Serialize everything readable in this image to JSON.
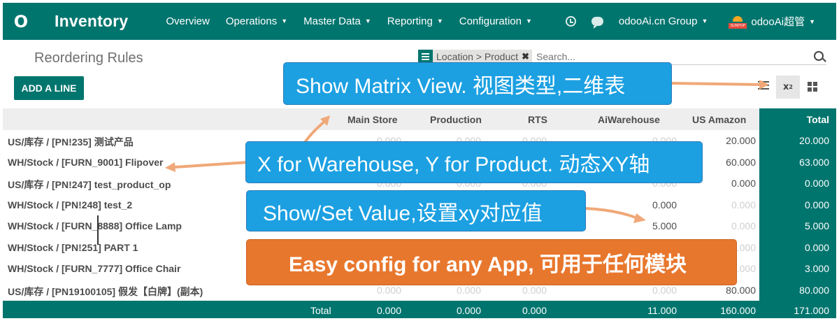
{
  "navbar": {
    "logo": "O",
    "app_title": "Inventory",
    "menu": [
      "Overview",
      "Operations",
      "Master Data",
      "Reporting",
      "Configuration"
    ],
    "menu_has_caret": [
      false,
      true,
      true,
      true,
      true
    ],
    "company": "odooAi.cn Group",
    "user": "odooAi超管",
    "avatar_text": "SUNPOP"
  },
  "control": {
    "breadcrumb": "Reordering Rules",
    "search_facet": "Location > Product",
    "search_placeholder": "Search...",
    "add_button": "ADD A LINE",
    "matrix_view_label": "x",
    "matrix_view_sub": "2"
  },
  "table": {
    "columns": [
      "Main Store",
      "Production",
      "RTS",
      "AiWarehouse",
      "US Amazon"
    ],
    "total_header": "Total",
    "rows": [
      {
        "label": "US/库存 / [PN!235] 测试产品",
        "values": [
          "0.000",
          "0.000",
          "0.000",
          "0.000",
          "20.000"
        ],
        "set": [
          false,
          false,
          false,
          false,
          true
        ],
        "total": "20.000"
      },
      {
        "label": "WH/Stock / [FURN_9001] Flipover",
        "values": [
          "",
          "",
          "",
          "",
          "60.000"
        ],
        "set": [
          false,
          false,
          false,
          false,
          true
        ],
        "total": "63.000"
      },
      {
        "label": "US/库存 / [PN!247] test_product_op",
        "values": [
          "0.000",
          "0.000",
          "0.000",
          "0.000",
          "0.000"
        ],
        "set": [
          false,
          false,
          false,
          false,
          true
        ],
        "total": "0.000"
      },
      {
        "label": "WH/Stock / [PN!248] test_2",
        "values": [
          "",
          "",
          "",
          "0.000",
          "0.000"
        ],
        "set": [
          false,
          false,
          false,
          true,
          false
        ],
        "total": "0.000"
      },
      {
        "label": "WH/Stock / [FURN_8888] Office Lamp",
        "values": [
          "",
          "",
          "",
          "5.000",
          "0.000"
        ],
        "set": [
          false,
          false,
          false,
          true,
          false
        ],
        "total": "5.000"
      },
      {
        "label": "WH/Stock / [PN!251] PART 1",
        "values": [
          "",
          "",
          "",
          "",
          "0.000"
        ],
        "set": [
          false,
          false,
          false,
          false,
          false
        ],
        "total": "0.000"
      },
      {
        "label": "WH/Stock / [FURN_7777] Office Chair",
        "values": [
          "",
          "",
          "",
          "",
          "0.000"
        ],
        "set": [
          false,
          false,
          false,
          false,
          false
        ],
        "total": "3.000"
      },
      {
        "label": "US/库存 / [PN19100105] 假发【白牌】(副本)",
        "values": [
          "0.000",
          "0.000",
          "0.000",
          "0.000",
          "80.000"
        ],
        "set": [
          false,
          false,
          false,
          false,
          true
        ],
        "total": "80.000"
      }
    ],
    "footer_label": "Total",
    "footer_values": [
      "0.000",
      "0.000",
      "0.000",
      "11.000",
      "160.000"
    ],
    "footer_total": "171.000"
  },
  "callouts": {
    "matrix": "Show Matrix View. 视图类型,二维表",
    "axes": "X for Warehouse, Y for Product. 动态XY轴",
    "values": "Show/Set Value,设置xy对应值",
    "config": "Easy config for any App, 可用于任何模块"
  },
  "colors": {
    "primary": "#00756e",
    "callout_blue": "#1ca0e2",
    "callout_orange": "#e8772e",
    "arrow": "#f0a878"
  }
}
